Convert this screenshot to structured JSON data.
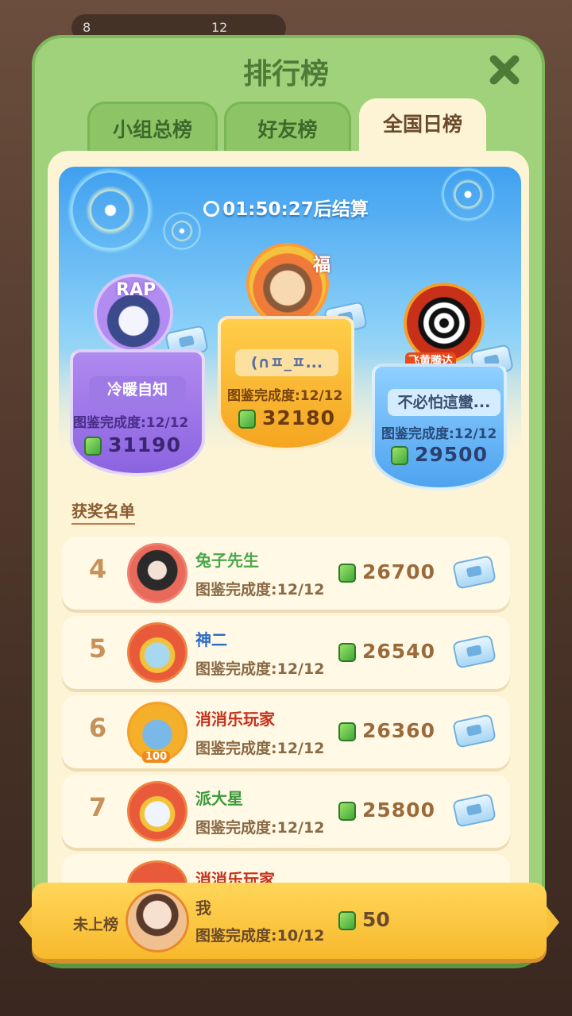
{
  "header": {
    "title": "排行榜"
  },
  "topbar": {
    "left_value": "8",
    "right_value": "12"
  },
  "tabs": [
    {
      "label": "小组总榜",
      "active": false
    },
    {
      "label": "好友榜",
      "active": false
    },
    {
      "label": "全国日榜",
      "active": true
    }
  ],
  "timer": {
    "text": "01:50:27后结算"
  },
  "podium": [
    {
      "place": 2,
      "name": "冷暖自知",
      "completion": "图鉴完成度:12/12",
      "score": "31190",
      "avatar_text": "RAP"
    },
    {
      "place": 1,
      "name": "(∩ㅍ_ㅍ...",
      "completion": "图鉴完成度:12/12",
      "score": "32180",
      "avatar_text": "福"
    },
    {
      "place": 3,
      "name": "不必怕這蠻...",
      "completion": "图鉴完成度:12/12",
      "score": "29500",
      "avatar_text": "飞黄腾达"
    }
  ],
  "winners_label": "获奖名单",
  "list": [
    {
      "rank": "4",
      "name": "兔子先生",
      "completion": "图鉴完成度:12/12",
      "score": "26700"
    },
    {
      "rank": "5",
      "name": "神二",
      "completion": "图鉴完成度:12/12",
      "score": "26540"
    },
    {
      "rank": "6",
      "name": "消消乐玩家",
      "completion": "图鉴完成度:12/12",
      "score": "26360",
      "avatar_badge": "100"
    },
    {
      "rank": "7",
      "name": "派大星",
      "completion": "图鉴完成度:12/12",
      "score": "25800"
    },
    {
      "rank": "",
      "name": "消消乐玩家",
      "completion": "",
      "score": ""
    }
  ],
  "me": {
    "rank_label": "未上榜",
    "name": "我",
    "completion": "图鉴完成度:10/12",
    "score": "50"
  },
  "colors": {
    "panel_green": "#9fd27a",
    "cream": "#fdf4d6",
    "gold": "#f7b92c",
    "score_brown": "#9a6a3a"
  }
}
